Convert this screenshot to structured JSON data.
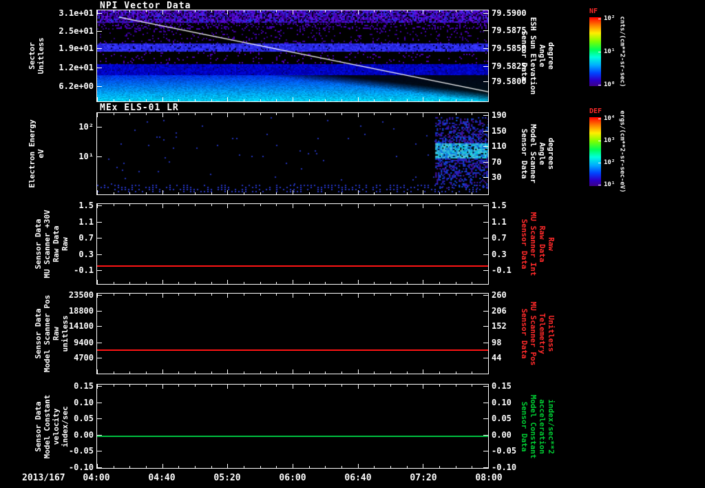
{
  "window": {
    "background": "#000000",
    "foreground": "#ffffff"
  },
  "chart_data": {
    "type": "heatmap",
    "description": "Five stacked time-series panels: NPI sector-count spectrogram, MEx ELS-01 LR electron energy spectrogram, and three constant-value line plots, 2013/167 04:00-08:00",
    "xaxis": {
      "date_label": "2013/167",
      "tick_labels": [
        "04:00",
        "04:40",
        "05:20",
        "06:00",
        "06:40",
        "07:20",
        "08:00"
      ]
    },
    "panels": [
      {
        "id": "npi",
        "kind": "spectrogram",
        "title": "NPI Vector Data",
        "left_label_lines": [
          "Sector",
          "Unitless"
        ],
        "left_label_color": "#ffffff",
        "left_ticks": [
          {
            "label": "3.1e+01",
            "frac": 0.03
          },
          {
            "label": "2.5e+01",
            "frac": 0.225
          },
          {
            "label": "1.9e+01",
            "frac": 0.42
          },
          {
            "label": "1.2e+01",
            "frac": 0.63
          },
          {
            "label": "6.2e+00",
            "frac": 0.835
          }
        ],
        "right_ticks": [
          {
            "label": "79.5900",
            "frac": 0.03
          },
          {
            "label": "79.5875",
            "frac": 0.22
          },
          {
            "label": "79.5850",
            "frac": 0.42
          },
          {
            "label": "79.5825",
            "frac": 0.61
          },
          {
            "label": "79.5800",
            "frac": 0.78
          }
        ],
        "right_label_lines": [
          "Sensor Data",
          "ESH Sun Elevation",
          "Angle",
          "degree"
        ],
        "right_label_color": "#ffffff",
        "spectro": {
          "seed": 11,
          "regions": [
            {
              "mode": "noise",
              "y0": 0.0,
              "y1": 0.13,
              "density": 0.78,
              "cell": 2,
              "bg": "#08001a",
              "colors": [
                "#4a00b8",
                "#6012e0",
                "#30008c",
                "#2a2ae0"
              ]
            },
            {
              "mode": "noise",
              "y0": 0.13,
              "y1": 0.2,
              "density": 0.25,
              "cell": 2,
              "bg": "#000000",
              "colors": [
                "#4a00b8",
                "#38009c"
              ]
            },
            {
              "mode": "noise",
              "y0": 0.2,
              "y1": 0.36,
              "density": 0.1,
              "cell": 2,
              "bg": "#000000",
              "colors": [
                "#4a00b8",
                "#30008c"
              ]
            },
            {
              "mode": "noise",
              "y0": 0.36,
              "y1": 0.45,
              "density": 0.92,
              "cell": 2,
              "bg": "#000040",
              "colors": [
                "#2828e8",
                "#2020cc",
                "#3838ff"
              ]
            },
            {
              "mode": "noise",
              "y0": 0.45,
              "y1": 0.59,
              "density": 0.07,
              "cell": 2,
              "bg": "#000000",
              "colors": [
                "#4a00b8"
              ]
            },
            {
              "mode": "noise",
              "y0": 0.59,
              "y1": 0.71,
              "density": 0.95,
              "cell": 2,
              "bg": "#000070",
              "colors": [
                "#0000c0",
                "#0008dc",
                "#0000a8"
              ]
            },
            {
              "mode": "wedge",
              "y0": 0.71,
              "y1": 1.0,
              "c0": "#0034e8",
              "c1": "#00d4ff",
              "cut0": 0.42,
              "cut1": 0.97,
              "fade": 0.22
            }
          ],
          "overlay_line": {
            "x0": 0.056,
            "y0": 0.075,
            "x1": 1.0,
            "y1": 0.895,
            "color": "#ffffff"
          }
        },
        "colorbar_ref": "NF"
      },
      {
        "id": "els",
        "kind": "spectrogram",
        "title": "MEx ELS-01 LR",
        "left_label_lines": [
          "Electron Energy",
          "eV"
        ],
        "left_label_color": "#ffffff",
        "left_ticks": [
          {
            "label": "10²",
            "frac": 0.167
          },
          {
            "label": "10¹",
            "frac": 0.533
          }
        ],
        "right_ticks": [
          {
            "label": "190",
            "frac": 0.025
          },
          {
            "label": "150",
            "frac": 0.217
          },
          {
            "label": "110",
            "frac": 0.41
          },
          {
            "label": "70",
            "frac": 0.6
          },
          {
            "label": "30",
            "frac": 0.79
          }
        ],
        "right_label_lines": [
          "Sensor Data",
          "Model Scanner",
          "Angle",
          "degrees"
        ],
        "right_label_color": "#ffffff",
        "spectro": {
          "seed": 29,
          "regions": [
            {
              "mode": "noise",
              "y0": 0.05,
              "y1": 0.88,
              "density": 0.004,
              "cell": 2,
              "bg": "#000000",
              "colors": [
                "#2233bb"
              ]
            },
            {
              "mode": "dots",
              "y0": 0.88,
              "y1": 0.97,
              "density": 0.5,
              "colors": [
                "#2636c8"
              ]
            }
          ],
          "patch": {
            "x0": 0.865,
            "x1": 1.0,
            "y0": 0.05,
            "y1": 0.93,
            "band_y0": 0.36,
            "band_y1": 0.56
          }
        },
        "colorbar_ref": "DEF"
      },
      {
        "id": "mu30v",
        "kind": "line",
        "left_label_lines": [
          "Sensor Data",
          "MU Scanner +30V",
          "Raw Data",
          "Raw"
        ],
        "left_label_color": "#ffffff",
        "left_ticks": [
          {
            "label": "1.5",
            "frac": 0.02
          },
          {
            "label": "1.1",
            "frac": 0.22
          },
          {
            "label": "0.7",
            "frac": 0.42
          },
          {
            "label": "0.3",
            "frac": 0.63
          },
          {
            "label": "-0.1",
            "frac": 0.83
          }
        ],
        "right_ticks": [
          {
            "label": "1.5",
            "frac": 0.02
          },
          {
            "label": "1.1",
            "frac": 0.22
          },
          {
            "label": "0.7",
            "frac": 0.42
          },
          {
            "label": "0.3",
            "frac": 0.63
          },
          {
            "label": "-0.1",
            "frac": 0.83
          }
        ],
        "right_label_lines": [
          "Sensor Data",
          "MU Scanner Int",
          "Raw Data",
          "Raw"
        ],
        "right_label_color": "#ff2a2a",
        "line": {
          "frac": 0.77,
          "color": "#ff1414",
          "value": 0.0
        }
      },
      {
        "id": "scanpos",
        "kind": "line",
        "left_label_lines": [
          "Sensor Data",
          "Model Scanner Pos",
          "Raw",
          "unitless"
        ],
        "left_label_color": "#ffffff",
        "left_ticks": [
          {
            "label": "23500",
            "frac": 0.017
          },
          {
            "label": "18800",
            "frac": 0.212
          },
          {
            "label": "14100",
            "frac": 0.407
          },
          {
            "label": "9400",
            "frac": 0.61
          },
          {
            "label": "4700",
            "frac": 0.805
          }
        ],
        "right_ticks": [
          {
            "label": "260",
            "frac": 0.017
          },
          {
            "label": "206",
            "frac": 0.212
          },
          {
            "label": "152",
            "frac": 0.407
          },
          {
            "label": "98",
            "frac": 0.61
          },
          {
            "label": "44",
            "frac": 0.805
          }
        ],
        "right_label_lines": [
          "Sensor Data",
          "MU Scanner Pos",
          "Telemetry",
          "Unitless"
        ],
        "right_label_color": "#ff2a2a",
        "line": {
          "frac": 0.695,
          "color": "#ff1414",
          "value_left": 7400,
          "value_right": 80
        }
      },
      {
        "id": "modelconst",
        "kind": "line",
        "left_label_lines": [
          "Sensor Data",
          "Model Constant",
          "velocity",
          "index/sec"
        ],
        "left_label_color": "#ffffff",
        "left_ticks": [
          {
            "label": "0.15",
            "frac": 0.016
          },
          {
            "label": "0.10",
            "frac": 0.211
          },
          {
            "label": "0.05",
            "frac": 0.407
          },
          {
            "label": "0.00",
            "frac": 0.602
          },
          {
            "label": "-0.05",
            "frac": 0.797
          },
          {
            "label": "-0.10",
            "frac": 0.992
          }
        ],
        "right_ticks": [
          {
            "label": "0.15",
            "frac": 0.016
          },
          {
            "label": "0.10",
            "frac": 0.211
          },
          {
            "label": "0.05",
            "frac": 0.407
          },
          {
            "label": "0.00",
            "frac": 0.602
          },
          {
            "label": "-0.05",
            "frac": 0.797
          },
          {
            "label": "-0.10",
            "frac": 0.992
          }
        ],
        "right_label_lines": [
          "Sensor Data",
          "Model Constant",
          "acceleration",
          "index/sec**2"
        ],
        "right_label_color": "#00cc33",
        "line": {
          "frac": 0.615,
          "color": "#00c040",
          "value": 0.0
        }
      }
    ],
    "colorbars": [
      {
        "title": "NF",
        "title_color": "#ff2a2a",
        "unit": "cnts/(cm**2-sr-sec)",
        "ticks": [
          {
            "label": "10²",
            "frac": 0.02
          },
          {
            "label": "10¹",
            "frac": 0.5
          },
          {
            "label": "10⁰",
            "frac": 0.98
          }
        ]
      },
      {
        "title": "DEF",
        "title_color": "#ff2a2a",
        "unit": "ergs/(cm**2-sr-sec-eV)",
        "ticks": [
          {
            "label": "10⁴",
            "frac": 0.02
          },
          {
            "label": "10³",
            "frac": 0.34
          },
          {
            "label": "10²",
            "frac": 0.66
          },
          {
            "label": "10¹",
            "frac": 0.98
          }
        ]
      }
    ]
  }
}
